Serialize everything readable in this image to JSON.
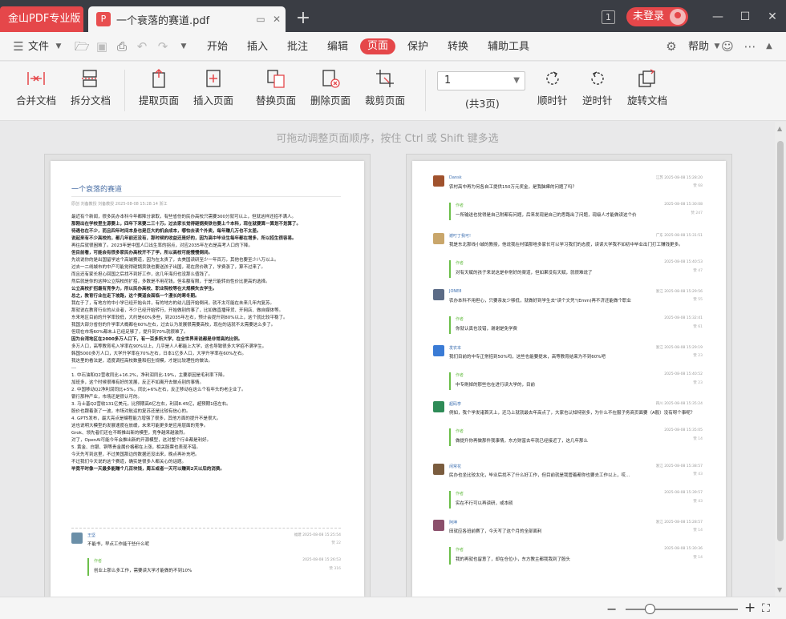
{
  "titlebar": {
    "brand": "金山PDF专业版",
    "doc_tab_title": "一个衰落的赛道.pdf",
    "count_badge": "1",
    "login_label": "未登录"
  },
  "menubar": {
    "file_label": "文件",
    "tabs": [
      "开始",
      "插入",
      "批注",
      "编辑",
      "页面",
      "保护",
      "转换",
      "辅助工具"
    ],
    "help_label": "帮助"
  },
  "ribbon": {
    "buttons": [
      "合并文档",
      "拆分文档",
      "提取页面",
      "插入页面",
      "替换页面",
      "删除页面",
      "裁剪页面",
      "顺时针",
      "逆时针",
      "旋转文档"
    ],
    "page_select_value": "1",
    "page_total": "(共3页)"
  },
  "hint": "可拖动调整页面顺序，按住 Ctrl 或 Shift 键多选",
  "page1": {
    "title": "一个衰落的赛道",
    "meta": "原创  刘备教授  刘备教授  2025-08-08 15:28:14  浙江",
    "lines": [
      {
        "t": "最近有个新闻，很多民办本科今年都降分录取，有些省份的民办高校只需要300分就可以上，但就这样还招不满人。",
        "b": false
      },
      {
        "t": "那刚出在学校里生源要上，四年下来要二三十万。过去家长觉得砸锅卖铁也要上个本科，现在就要算一算划不划算了。",
        "b": true
      },
      {
        "t": "待遇也在不少，而且四年时间本身也是巨大的机会成本，哪怕去读个外卖，每年赚几万也不太差。",
        "b": true
      },
      {
        "t": "说起来有不少高校的，都几年前还没有，那时候的收益还是好的，因为高中毕业生每年都在增多，所以招生很容易。",
        "b": true
      },
      {
        "t": "再往后就很困难了。2023年是中国人口出生率的拐点，对应2035年左右是高考人口的下降。",
        "b": false
      },
      {
        "t": "但目前看，可能会有很多家民办高校开不了学，所以高校可能慢慢倒闭。",
        "b": true
      },
      {
        "t": "先说说你的是出国留学这个高端赛道，因为在太贵了，去美国读研至少一年百万，其他也要至少八万以上。",
        "b": false
      },
      {
        "t": "过去一二线城市的中产可能觉得砸锅卖铁也要送孩子出国，现在房价跌了，学费涨了，算不过来了。",
        "b": false
      },
      {
        "t": "而且还有家长担心回国之后找不到好工作，这几年海归也没那么值钱了。",
        "b": false
      },
      {
        "t": "然后就是你的这种公立院校的扩招，多数是不用花钱，但名额有限，于是只能转向性价比更高的选择。",
        "b": false
      },
      {
        "t": "公立高校扩招最有竞争力，所以民办高校、职业院校等在大规模失去学生。",
        "b": true
      },
      {
        "t": "总之，教育行业在走下坡路，这个赛道会面临一个漫长的寒冬期。",
        "b": true
      },
      {
        "t": "我在于了，有地方的中小学已经开始合并，有的地方的幼儿园开始倒闭，就不太可能在未来几年内复苏。",
        "b": false
      },
      {
        "t": "那就说在教育行业的从业者，不少已经开始转行，开始做别的事了，比如做直播带货、开网店、做自媒体等。",
        "b": false
      },
      {
        "t": "东来地区目前的升学率较低，大约是60%多些，到2035年左右，预计会提升到80%以上，这个就比较平稳了。",
        "b": false
      },
      {
        "t": "我国大部分省份的升学率大概都在60%左右，过去认为发展很需要高校，现在的话就不太需要这么多了。",
        "b": false
      },
      {
        "t": "但现在市场60%都未上已经足够了，提升到70%就很难了。",
        "b": false
      },
      {
        "t": "因为台湾地区在2000多万人口下，有一百多所大学，在全世界来说都是非常高的比例。",
        "b": true
      },
      {
        "t": "多万人口，高等教育毛入学率在90%以上，几乎是人人都能上大学，这也导致很多大学招不满学生。",
        "b": false
      },
      {
        "t": "韩国5000多万人口，大学升学率在70%左右，日本1亿多人口，大学升学率在60%左右。",
        "b": false
      },
      {
        "t": "我这里的看法是，适度调控高校数量和招生规模，才是比较理性的做法。",
        "b": false
      },
      {
        "t": "---",
        "b": false
      },
      {
        "t": "1. 中石油和Q2营收同比+16.2%，净利润同比-19%，主要原因是毛利率下降。",
        "b": false
      },
      {
        "t": "加班多，这个时候很难有好的发展，反正不如离开去做点别的事情。",
        "b": false
      },
      {
        "t": "2. 中国移动Q2净利润同比+5%，同比+6%左右，反正移动在这么个有年头的老企业了。",
        "b": false
      },
      {
        "t": "银行那种产业，市场还是很认可的。",
        "b": false
      },
      {
        "t": "3. 马士基Q2营收131亿美元，比预期高6亿左右，利润8.45亿，超预期1倍左右。",
        "b": false
      },
      {
        "t": "股价也跟着涨了一波，市场对航运的复苏还是比较有信心的。",
        "b": false
      },
      {
        "t": "4. GPT5发布，最大亮点是编程能力增强了很多，其他方面的提升不是很大。",
        "b": false
      },
      {
        "t": "这也说明大模型的发展速度在放缓，未来可能更多是应用层面的竞争。",
        "b": false
      },
      {
        "t": "Grok、领先者们还在不断推出新的模型，竞争越来越激烈。",
        "b": false
      },
      {
        "t": "对了，OpenAI可能今年会推出新的开源模型，这对整个行业都是利好。",
        "b": false
      },
      {
        "t": "5. 黄金、白银、铜等贵金属价格都在上涨，相关股票也表现不错。",
        "b": false
      },
      {
        "t": "今天先写到这里，不过美国那边的数据还没出来，晚点再补充吧。",
        "b": false
      },
      {
        "t": "不过我们今天说的这个赛道，确实是很多人都关心的话题。",
        "b": false
      },
      {
        "t": "毕竟平时像一天最多能赚个几百块钱，周五或者一天可以赚到2天以后的消费。",
        "b": true
      }
    ],
    "comment": {
      "user": "王坚",
      "time": "福建  2025-08-08 15:25:54",
      "text": "不能书，早点工作能干些什么呢",
      "zan": "赞 22"
    },
    "reply": {
      "who": "作者",
      "time": "2025-08-08 15:26:53",
      "text": "创业上那么多工作，需要读大学才能做的不到10%",
      "zan": "赞 316"
    }
  },
  "page2": {
    "comments": [
      {
        "user": "Dansk",
        "time": "江苏  2025-08-08 15:28:20",
        "text": "农村高中再为何各自工提供150万元奖金，是我脑瘫的问题了吗？",
        "zan": "赞 68"
      },
      {
        "user": "谢叮丁我可!",
        "time": "广东  2025-08-08 15:31:51",
        "text": "我是东北那线小城的教授，他说我在村镇那啥多家长可以学习我们的态度，读读大学我不如初中毕业出门打工赚钱更多。",
        "zan": ""
      },
      {
        "user": "JONE8",
        "time": "浙江  2025-08-08 15:29:56",
        "text": "农办本科不用担心，只要亲友少够低，就做好到学生去\"读个文凭\"(Emm)再不济还能做个职业",
        "zan": "赞 55"
      },
      {
        "user": "发农本",
        "time": "浙江  2025-08-08 15:29:19",
        "text": "我们目前的中专正常招到50%吗，这些也能要提末，高等教育结束为不到60%吧",
        "zan": "赞 23"
      },
      {
        "user": "超码亭",
        "time": "四川  2025-08-08 15:35:24",
        "text": "例如，我个学发诸首天上，还马上就就最去年高点了，大家也认知特别多，为什么不在服子务商页面要（A股）没有呀个事呢？",
        "zan": ""
      },
      {
        "user": "闲常花",
        "time": "浙江  2025-08-08 15:38:57",
        "text": "民办也坐比较太化，毕业后找不了什么好工作，但目前就是我管着都你也要去工作以上，哎…",
        "zan": "赞 43"
      },
      {
        "user": "阿坤",
        "time": "浙江  2025-08-08 15:28:57",
        "text": "田就应各班前赛了，今天写了这个月的全部面利",
        "zan": "赞 14"
      }
    ],
    "replies": [
      {
        "who": "作者",
        "time": "2025-08-08 15:30:08",
        "text": "一所输送也觉得是自己附都有问题，后来发现是自己的思路出了问题，现级人才能做读这个价",
        "zan": "赞 247"
      },
      {
        "who": "作者",
        "time": "2025-08-08 15:40:53",
        "text": "对有天赋的孩子来说这是非常好的渠道，但如果没有天赋，就很难说了",
        "zan": "赞 47"
      },
      {
        "who": "作者",
        "time": "2025-08-08 15:32:41",
        "text": "你就认真也没错，谢谢是免学费",
        "zan": "赞 61"
      },
      {
        "who": "作者",
        "time": "2025-08-08 15:40:52",
        "text": "中专刷掉的那些也在进行读大学的，目前",
        "zan": "赞 23"
      },
      {
        "who": "作者",
        "time": "2025-08-08 15:35:05",
        "text": "做提升你再做那件我事情，东方财富去年就已经接近了，这几年那么",
        "zan": "赞 14"
      },
      {
        "who": "作者",
        "time": "2025-08-08 15:39:57",
        "text": "实在不行可以再读研，或本硕",
        "zan": "赞 43"
      },
      {
        "who": "作者",
        "time": "2025-08-08 15:30:36",
        "text": "我的再就也留意了，却在仓位小，东方教主都我我到了股头",
        "zan": "赞 14"
      }
    ]
  },
  "statusbar": {
    "zoom_minus": "−",
    "zoom_plus": "+"
  }
}
